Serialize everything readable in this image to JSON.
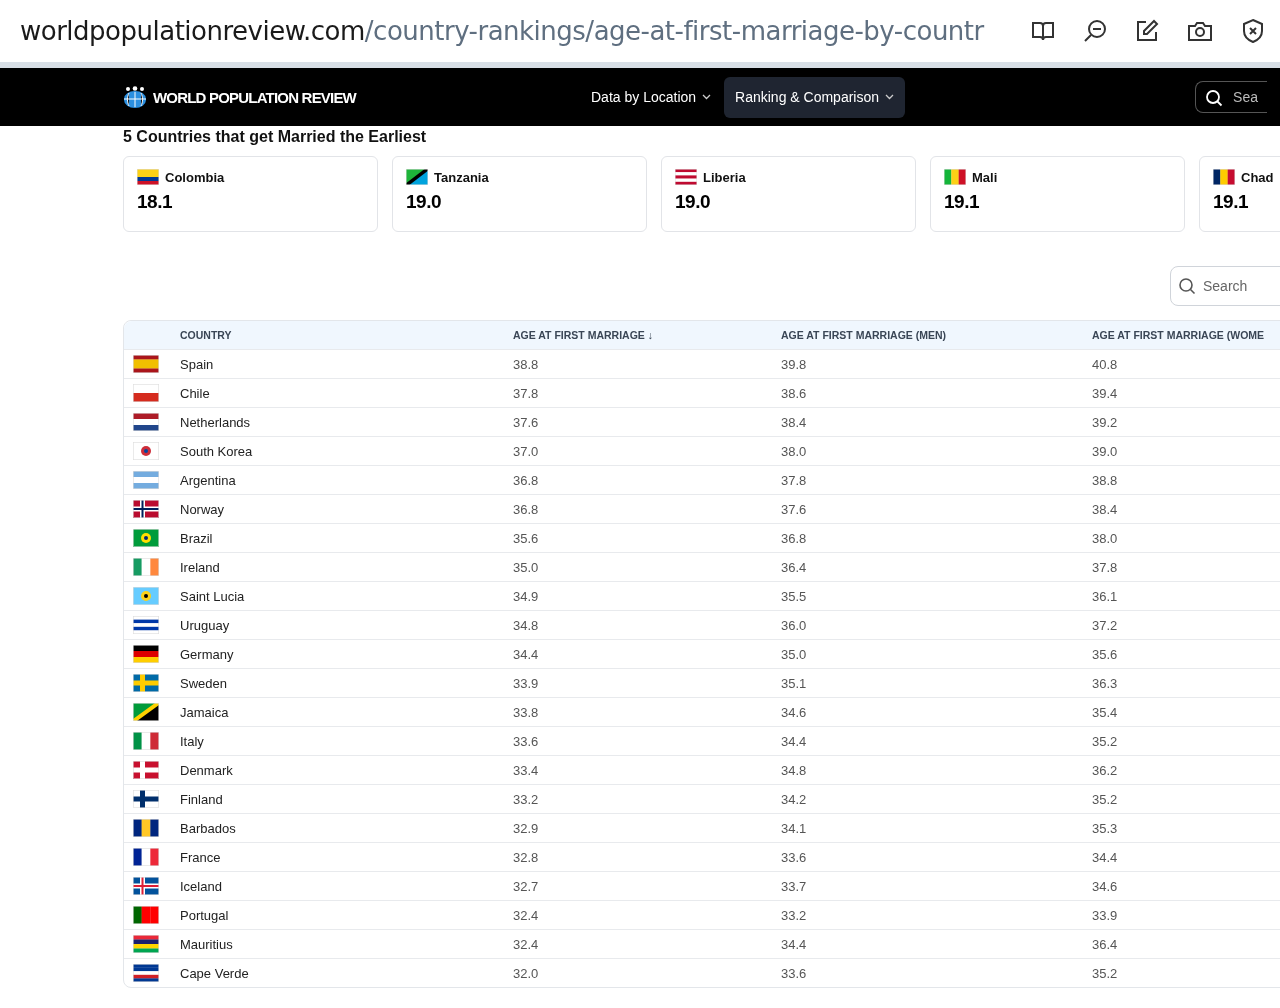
{
  "address_bar": {
    "domain": "worldpopulationreview.com",
    "path": "/country-rankings/age-at-first-marriage-by-countr"
  },
  "nav": {
    "logo": "WORLD POPULATION REVIEW",
    "menus": [
      {
        "label": "Data by Location",
        "selected": false
      },
      {
        "label": "Ranking & Comparison",
        "selected": true
      }
    ],
    "search_placeholder": "Sea"
  },
  "earliest": {
    "title": "5 Countries that get Married the Earliest",
    "cards": [
      {
        "name": "Colombia",
        "value": "18.1"
      },
      {
        "name": "Tanzania",
        "value": "19.0"
      },
      {
        "name": "Liberia",
        "value": "19.0"
      },
      {
        "name": "Mali",
        "value": "19.1"
      },
      {
        "name": "Chad",
        "value": "19.1"
      }
    ]
  },
  "search": {
    "placeholder": "Search"
  },
  "table": {
    "columns": [
      "COUNTRY",
      "AGE AT FIRST MARRIAGE ↓",
      "AGE AT FIRST MARRIAGE (MEN)",
      "AGE AT FIRST MARRIAGE (WOME"
    ],
    "rows": [
      {
        "country": "Spain",
        "values": [
          "38.8",
          "39.8",
          "40.8"
        ]
      },
      {
        "country": "Chile",
        "values": [
          "37.8",
          "38.6",
          "39.4"
        ]
      },
      {
        "country": "Netherlands",
        "values": [
          "37.6",
          "38.4",
          "39.2"
        ]
      },
      {
        "country": "South Korea",
        "values": [
          "37.0",
          "38.0",
          "39.0"
        ]
      },
      {
        "country": "Argentina",
        "values": [
          "36.8",
          "37.8",
          "38.8"
        ]
      },
      {
        "country": "Norway",
        "values": [
          "36.8",
          "37.6",
          "38.4"
        ]
      },
      {
        "country": "Brazil",
        "values": [
          "35.6",
          "36.8",
          "38.0"
        ]
      },
      {
        "country": "Ireland",
        "values": [
          "35.0",
          "36.4",
          "37.8"
        ]
      },
      {
        "country": "Saint Lucia",
        "values": [
          "34.9",
          "35.5",
          "36.1"
        ]
      },
      {
        "country": "Uruguay",
        "values": [
          "34.8",
          "36.0",
          "37.2"
        ]
      },
      {
        "country": "Germany",
        "values": [
          "34.4",
          "35.0",
          "35.6"
        ]
      },
      {
        "country": "Sweden",
        "values": [
          "33.9",
          "35.1",
          "36.3"
        ]
      },
      {
        "country": "Jamaica",
        "values": [
          "33.8",
          "34.6",
          "35.4"
        ]
      },
      {
        "country": "Italy",
        "values": [
          "33.6",
          "34.4",
          "35.2"
        ]
      },
      {
        "country": "Denmark",
        "values": [
          "33.4",
          "34.8",
          "36.2"
        ]
      },
      {
        "country": "Finland",
        "values": [
          "33.2",
          "34.2",
          "35.2"
        ]
      },
      {
        "country": "Barbados",
        "values": [
          "32.9",
          "34.1",
          "35.3"
        ]
      },
      {
        "country": "France",
        "values": [
          "32.8",
          "33.6",
          "34.4"
        ]
      },
      {
        "country": "Iceland",
        "values": [
          "32.7",
          "33.7",
          "34.6"
        ]
      },
      {
        "country": "Portugal",
        "values": [
          "32.4",
          "33.2",
          "33.9"
        ]
      },
      {
        "country": "Mauritius",
        "values": [
          "32.4",
          "34.4",
          "36.4"
        ]
      },
      {
        "country": "Cape Verde",
        "values": [
          "32.0",
          "33.6",
          "35.2"
        ]
      }
    ]
  }
}
